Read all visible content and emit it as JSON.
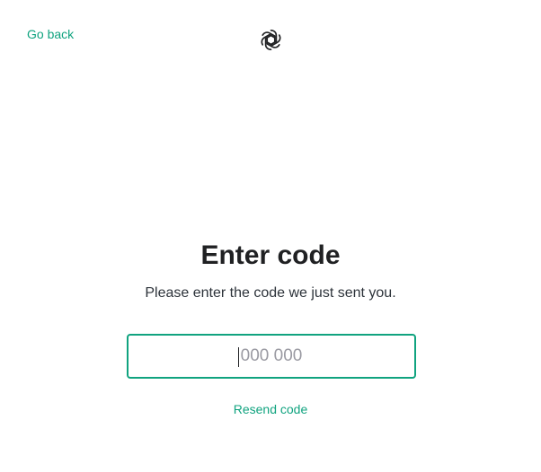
{
  "nav": {
    "go_back_label": "Go back"
  },
  "brand": {
    "logo_icon": "openai-logo-icon"
  },
  "main": {
    "title": "Enter code",
    "subtitle": "Please enter the code we just sent you.",
    "code_input": {
      "value": "",
      "placeholder": "000 000"
    },
    "resend_label": "Resend code"
  },
  "colors": {
    "accent": "#10a37f",
    "text": "#202123",
    "placeholder": "#9a9aa2",
    "background": "#ffffff"
  }
}
